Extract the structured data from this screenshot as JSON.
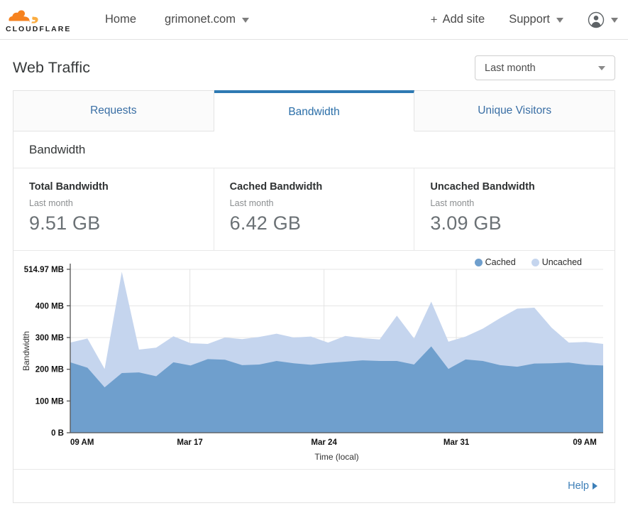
{
  "topnav": {
    "logo_text": "CLOUDFLARE",
    "home_label": "Home",
    "site_label": "grimonet.com",
    "add_site_label": "Add site",
    "add_site_plus": "+",
    "support_label": "Support"
  },
  "page": {
    "title": "Web Traffic",
    "range_value": "Last month"
  },
  "tabs": [
    {
      "label": "Requests",
      "active": false
    },
    {
      "label": "Bandwidth",
      "active": true
    },
    {
      "label": "Unique Visitors",
      "active": false
    }
  ],
  "panel": {
    "heading": "Bandwidth",
    "help_label": "Help"
  },
  "stats": [
    {
      "title": "Total Bandwidth",
      "sub": "Last month",
      "value": "9.51 GB"
    },
    {
      "title": "Cached Bandwidth",
      "sub": "Last month",
      "value": "6.42 GB"
    },
    {
      "title": "Uncached Bandwidth",
      "sub": "Last month",
      "value": "3.09 GB"
    }
  ],
  "colors": {
    "cached": "#6f9fcd",
    "uncached": "#c5d5ee",
    "accent": "#2e7ab3",
    "link": "#3d7fb8",
    "logo_orange": "#f6821f"
  },
  "chart_data": {
    "type": "area",
    "stacked": true,
    "title": "",
    "xlabel": "Time (local)",
    "ylabel": "Bandwidth",
    "ylim": [
      0,
      514.97
    ],
    "y_unit": "MB",
    "grid": true,
    "legend_position": "top-right",
    "y_ticks": [
      "0 B",
      "100 MB",
      "200 MB",
      "300 MB",
      "400 MB",
      "514.97 MB"
    ],
    "y_tick_values": [
      0,
      100,
      200,
      300,
      400,
      514.97
    ],
    "x_ticks": [
      "09 AM",
      "Mar 17",
      "Mar 24",
      "Mar 31",
      "09 AM"
    ],
    "x_tick_positions": [
      0,
      0.2245,
      0.4762,
      0.7245,
      0.9878
    ],
    "series": [
      {
        "name": "Cached",
        "color": "#6f9fcd",
        "values": [
          222,
          205,
          143,
          188,
          190,
          178,
          222,
          212,
          232,
          230,
          213,
          215,
          226,
          219,
          214,
          220,
          224,
          228,
          226,
          226,
          215,
          272,
          201,
          231,
          226,
          213,
          208,
          218,
          219,
          221,
          214,
          212
        ]
      },
      {
        "name": "Uncached",
        "color": "#c5d5ee",
        "values": [
          62,
          92,
          58,
          319,
          72,
          90,
          82,
          70,
          48,
          70,
          82,
          87,
          86,
          81,
          89,
          64,
          81,
          70,
          68,
          143,
          82,
          141,
          86,
          72,
          102,
          148,
          183,
          176,
          112,
          63,
          72,
          68
        ]
      }
    ],
    "total_values": [
      284,
      297,
      201,
      507,
      262,
      268,
      304,
      282,
      280,
      300,
      295,
      302,
      312,
      300,
      303,
      284,
      305,
      298,
      294,
      369,
      297,
      413,
      287,
      303,
      328,
      361,
      391,
      394,
      331,
      284,
      286,
      280
    ]
  }
}
